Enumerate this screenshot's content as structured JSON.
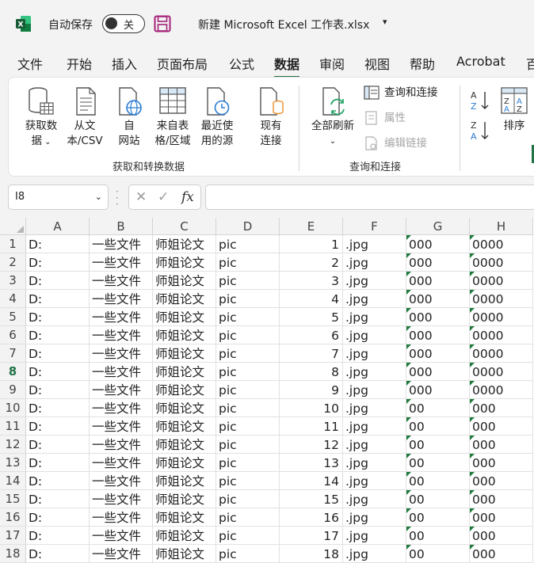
{
  "titlebar": {
    "autosave_label": "自动保存",
    "toggle_state": "关",
    "filename": "新建 Microsoft Excel 工作表.xlsx",
    "accent": "#217346"
  },
  "tabs": [
    "文件",
    "开始",
    "插入",
    "页面布局",
    "公式",
    "数据",
    "审阅",
    "视图",
    "帮助",
    "Acrobat",
    "百"
  ],
  "active_tab": "数据",
  "ribbon": {
    "get_data": [
      "获取数",
      "据"
    ],
    "from_text": [
      "从文",
      "本/CSV"
    ],
    "from_web": [
      "自",
      "网站"
    ],
    "from_table": [
      "来自表",
      "格/区域"
    ],
    "recent_sources": [
      "最近使",
      "用的源"
    ],
    "existing_connections": [
      "现有",
      "连接"
    ],
    "group1": "获取和转换数据",
    "refresh_all": "全部刷新",
    "queries_connections": "查询和连接",
    "properties": "属性",
    "edit_links": "编辑链接",
    "group2": "查询和连接",
    "sort": "排序"
  },
  "namebox": "I8",
  "formula_buttons": {
    "cancel": "✕",
    "enter": "✓",
    "fx": "fx"
  },
  "columns": [
    "A",
    "B",
    "C",
    "D",
    "E",
    "F",
    "G",
    "H"
  ],
  "active_row": 8,
  "rows": [
    {
      "n": "1",
      "a": "D:",
      "b": "一些文件",
      "c": "师姐论文",
      "d": "pic",
      "e": "1",
      "f": ".jpg",
      "g": "000",
      "h": "0000"
    },
    {
      "n": "2",
      "a": "D:",
      "b": "一些文件",
      "c": "师姐论文",
      "d": "pic",
      "e": "2",
      "f": ".jpg",
      "g": "000",
      "h": "0000"
    },
    {
      "n": "3",
      "a": "D:",
      "b": "一些文件",
      "c": "师姐论文",
      "d": "pic",
      "e": "3",
      "f": ".jpg",
      "g": "000",
      "h": "0000"
    },
    {
      "n": "4",
      "a": "D:",
      "b": "一些文件",
      "c": "师姐论文",
      "d": "pic",
      "e": "4",
      "f": ".jpg",
      "g": "000",
      "h": "0000"
    },
    {
      "n": "5",
      "a": "D:",
      "b": "一些文件",
      "c": "师姐论文",
      "d": "pic",
      "e": "5",
      "f": ".jpg",
      "g": "000",
      "h": "0000"
    },
    {
      "n": "6",
      "a": "D:",
      "b": "一些文件",
      "c": "师姐论文",
      "d": "pic",
      "e": "6",
      "f": ".jpg",
      "g": "000",
      "h": "0000"
    },
    {
      "n": "7",
      "a": "D:",
      "b": "一些文件",
      "c": "师姐论文",
      "d": "pic",
      "e": "7",
      "f": ".jpg",
      "g": "000",
      "h": "0000"
    },
    {
      "n": "8",
      "a": "D:",
      "b": "一些文件",
      "c": "师姐论文",
      "d": "pic",
      "e": "8",
      "f": ".jpg",
      "g": "000",
      "h": "0000"
    },
    {
      "n": "9",
      "a": "D:",
      "b": "一些文件",
      "c": "师姐论文",
      "d": "pic",
      "e": "9",
      "f": ".jpg",
      "g": "000",
      "h": "0000"
    },
    {
      "n": "10",
      "a": "D:",
      "b": "一些文件",
      "c": "师姐论文",
      "d": "pic",
      "e": "10",
      "f": ".jpg",
      "g": "00",
      "h": "000"
    },
    {
      "n": "11",
      "a": "D:",
      "b": "一些文件",
      "c": "师姐论文",
      "d": "pic",
      "e": "11",
      "f": ".jpg",
      "g": "00",
      "h": "000"
    },
    {
      "n": "12",
      "a": "D:",
      "b": "一些文件",
      "c": "师姐论文",
      "d": "pic",
      "e": "12",
      "f": ".jpg",
      "g": "00",
      "h": "000"
    },
    {
      "n": "13",
      "a": "D:",
      "b": "一些文件",
      "c": "师姐论文",
      "d": "pic",
      "e": "13",
      "f": ".jpg",
      "g": "00",
      "h": "000"
    },
    {
      "n": "14",
      "a": "D:",
      "b": "一些文件",
      "c": "师姐论文",
      "d": "pic",
      "e": "14",
      "f": ".jpg",
      "g": "00",
      "h": "000"
    },
    {
      "n": "15",
      "a": "D:",
      "b": "一些文件",
      "c": "师姐论文",
      "d": "pic",
      "e": "15",
      "f": ".jpg",
      "g": "00",
      "h": "000"
    },
    {
      "n": "16",
      "a": "D:",
      "b": "一些文件",
      "c": "师姐论文",
      "d": "pic",
      "e": "16",
      "f": ".jpg",
      "g": "00",
      "h": "000"
    },
    {
      "n": "17",
      "a": "D:",
      "b": "一些文件",
      "c": "师姐论文",
      "d": "pic",
      "e": "17",
      "f": ".jpg",
      "g": "00",
      "h": "000"
    },
    {
      "n": "18",
      "a": "D:",
      "b": "一些文件",
      "c": "师姐论文",
      "d": "pic",
      "e": "18",
      "f": ".jpg",
      "g": "00",
      "h": "000"
    }
  ]
}
